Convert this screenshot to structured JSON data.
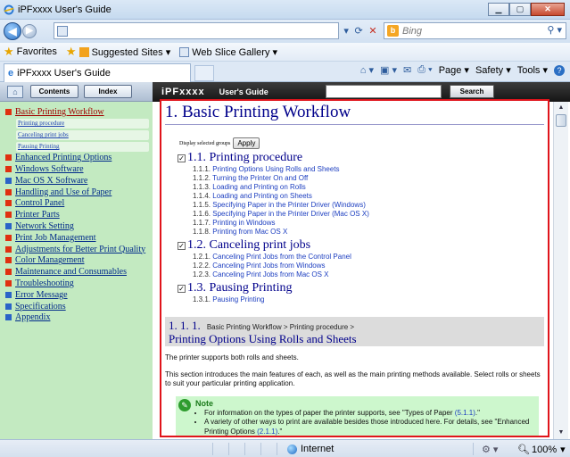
{
  "window": {
    "title": "iPFxxxx User's Guide",
    "min": "▁",
    "max": "▢",
    "close": "✕"
  },
  "addressbar": {
    "url": "",
    "search_placeholder": "Bing",
    "search_engine": "b"
  },
  "favorites": {
    "label": "Favorites",
    "suggested": "Suggested Sites ▾",
    "webslice": "Web Slice Gallery ▾"
  },
  "tab": {
    "title": "iPFxxxx User's Guide"
  },
  "commandbar": {
    "page": "Page ▾",
    "safety": "Safety ▾",
    "tools": "Tools ▾"
  },
  "leftpanel": {
    "contents_btn": "Contents",
    "index_btn": "Index",
    "items": [
      {
        "label": "Basic Printing Workflow",
        "active": true,
        "color": "red"
      },
      {
        "label": "Enhanced Printing Options",
        "color": "red"
      },
      {
        "label": "Windows Software",
        "color": "red"
      },
      {
        "label": "Mac OS X Software",
        "color": "blue"
      },
      {
        "label": "Handling and Use of Paper",
        "color": "red"
      },
      {
        "label": "Control Panel",
        "color": "red"
      },
      {
        "label": "Printer Parts",
        "color": "red"
      },
      {
        "label": "Network Setting",
        "color": "blue"
      },
      {
        "label": "Print Job Management",
        "color": "red"
      },
      {
        "label": "Adjustments for Better Print Quality",
        "color": "red"
      },
      {
        "label": "Color Management",
        "color": "red"
      },
      {
        "label": "Maintenance and Consumables",
        "color": "red"
      },
      {
        "label": "Troubleshooting",
        "color": "red"
      },
      {
        "label": "Error Message",
        "color": "blue"
      },
      {
        "label": "Specifications",
        "color": "blue"
      },
      {
        "label": "Appendix",
        "color": "blue"
      }
    ],
    "subitems": [
      "Printing procedure",
      "Canceling print jobs",
      "Pausing Printing"
    ]
  },
  "header": {
    "brand": "iPFxxxx",
    "guide": "User's Guide",
    "search_btn": "Search"
  },
  "doc": {
    "title": "1. Basic Printing Workflow",
    "display_groups": "Display selected groups",
    "apply": "Apply",
    "sections": [
      {
        "title": "1.1. Printing procedure",
        "items": [
          {
            "num": "1.1.1.",
            "text": "Printing Options Using Rolls and Sheets"
          },
          {
            "num": "1.1.2.",
            "text": "Turning the Printer On and Off"
          },
          {
            "num": "1.1.3.",
            "text": "Loading and Printing on Rolls"
          },
          {
            "num": "1.1.4.",
            "text": "Loading and Printing on Sheets"
          },
          {
            "num": "1.1.5.",
            "text": "Specifying Paper in the Printer Driver (Windows)"
          },
          {
            "num": "1.1.6.",
            "text": "Specifying Paper in the Printer Driver (Mac OS X)"
          },
          {
            "num": "1.1.7.",
            "text": "Printing in Windows"
          },
          {
            "num": "1.1.8.",
            "text": "Printing from Mac OS X"
          }
        ]
      },
      {
        "title": "1.2. Canceling print jobs",
        "items": [
          {
            "num": "1.2.1.",
            "text": "Canceling Print Jobs from the Control Panel"
          },
          {
            "num": "1.2.2.",
            "text": "Canceling Print Jobs from Windows"
          },
          {
            "num": "1.2.3.",
            "text": "Canceling Print Jobs from Mac OS X"
          }
        ]
      },
      {
        "title": "1.3. Pausing Printing",
        "items": [
          {
            "num": "1.3.1.",
            "text": "Pausing Printing"
          }
        ]
      }
    ],
    "section_num": "1. 1. 1.",
    "breadcrumb": "Basic Printing Workflow > Printing procedure >",
    "section_title": "Printing Options Using Rolls and Sheets",
    "para1": "The printer supports both rolls and sheets.",
    "para2": "This section introduces the main features of each, as well as the main printing methods available. Select rolls or sheets to suit your particular printing application.",
    "note_title": "Note",
    "note1_text": "For information on the types of paper the printer supports, see \"Types of Paper ",
    "note1_link": "(5.1.1)",
    "note1_end": ".\"",
    "note2_text": "A variety of other ways to print are available besides those introduced here. For details, see \"Enhanced Printing Options ",
    "note2_link": "(2.1.1)",
    "note2_end": ".\""
  },
  "status": {
    "zone": "Internet",
    "zoom": "100%"
  }
}
